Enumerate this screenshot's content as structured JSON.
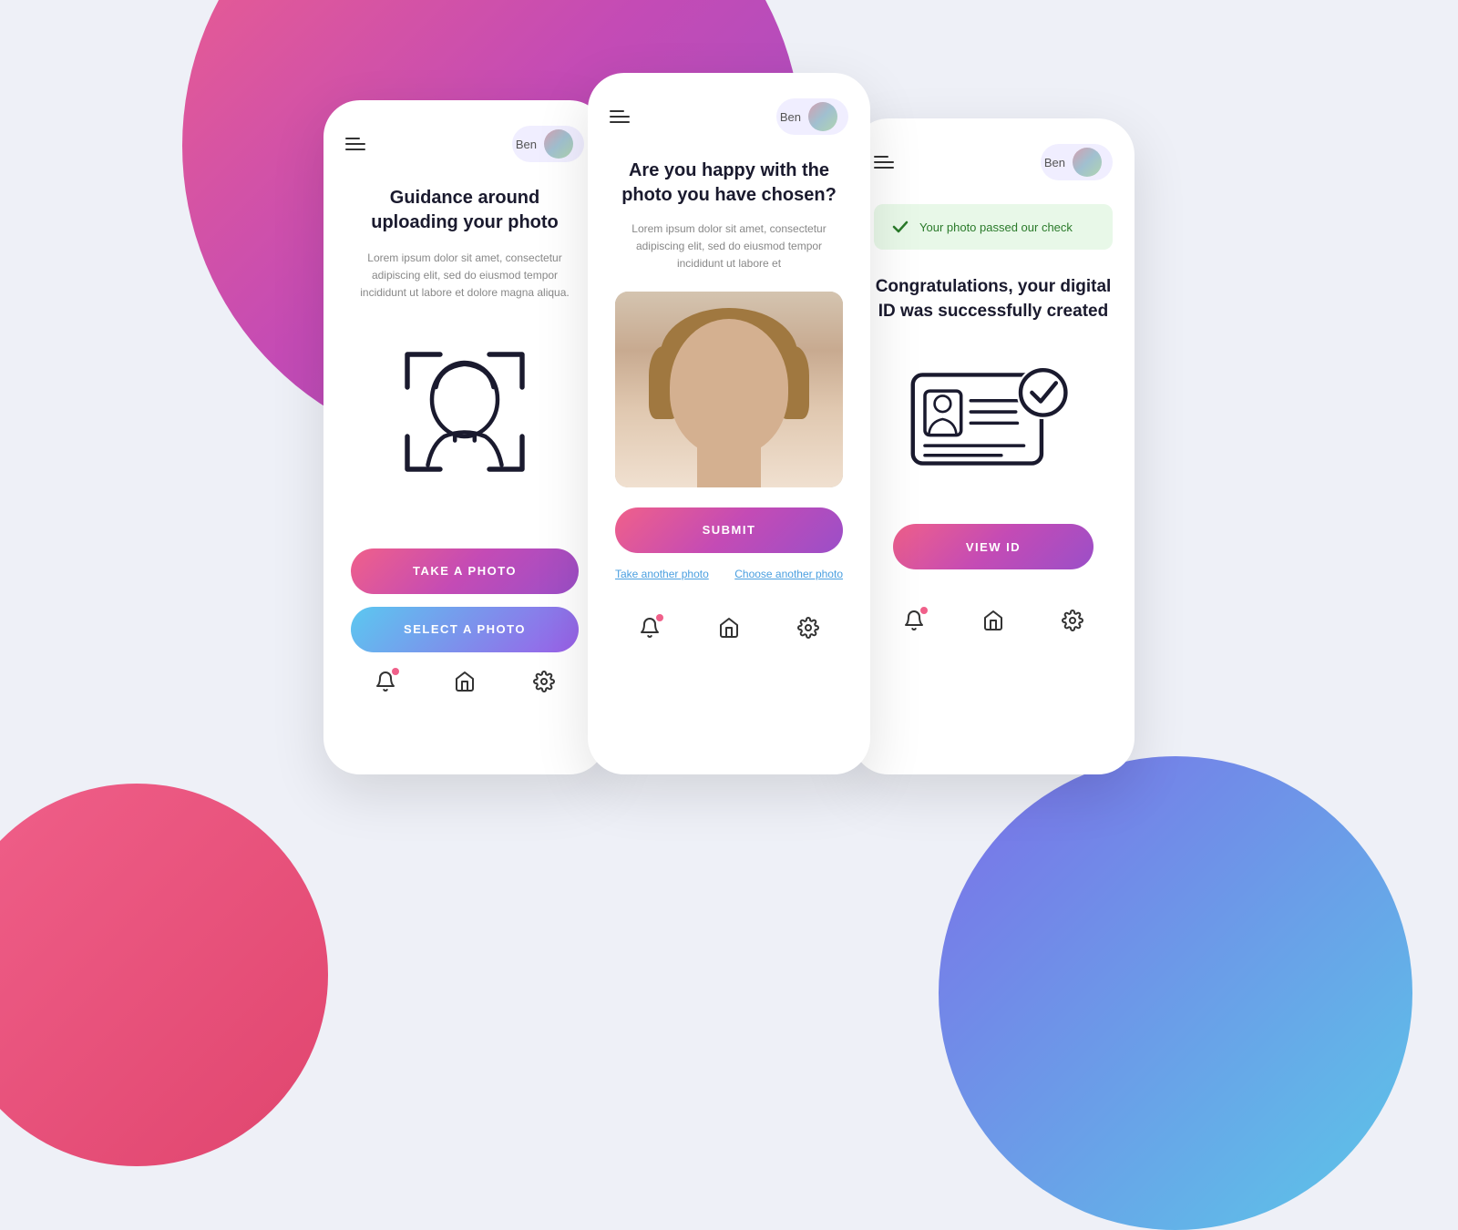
{
  "background": {
    "color": "#eef0f7"
  },
  "phone1": {
    "title": "Guidance around uploading your photo",
    "description": "Lorem ipsum dolor sit amet, consectetur adipiscing elit, sed do eiusmod tempor incididunt ut labore et dolore magna aliqua.",
    "btn_primary": "TAKE A PHOTO",
    "btn_secondary": "SELECT A PHOTO",
    "user_name": "Ben"
  },
  "phone2": {
    "title": "Are you happy with the photo you have chosen?",
    "description": "Lorem ipsum dolor sit amet, consectetur adipiscing elit, sed do eiusmod tempor incididunt ut labore et",
    "btn_submit": "SUBMIT",
    "link_take": "Take another photo",
    "link_choose": "Choose another photo",
    "user_name": "Ben"
  },
  "phone3": {
    "success_banner": "Your photo passed our check",
    "title": "Congratulations, your digital ID was successfully created",
    "btn_view": "VIEW ID",
    "user_name": "Ben"
  }
}
